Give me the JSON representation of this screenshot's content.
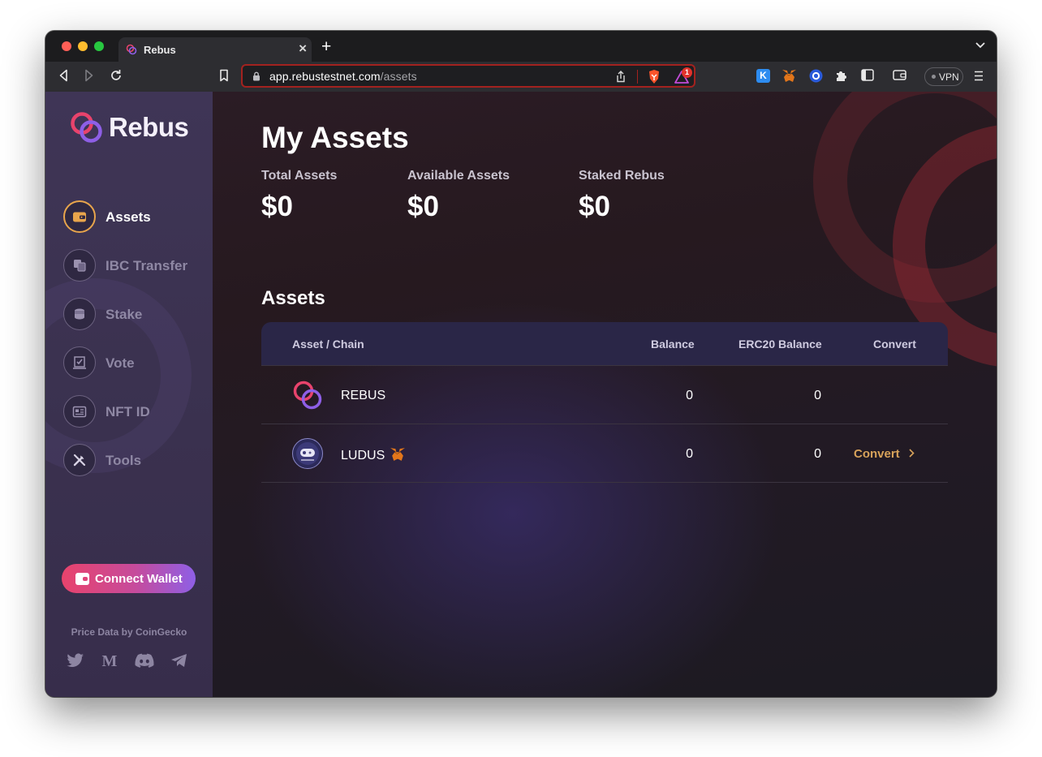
{
  "browser": {
    "tab_title": "Rebus",
    "url_host": "app.rebustestnet.com",
    "url_path": "/assets",
    "vpn_label": "VPN",
    "brave_badge": "1",
    "ext_k_label": "K"
  },
  "sidebar": {
    "logo_text": "Rebus",
    "items": [
      {
        "label": "Assets",
        "icon": "wallet-icon",
        "active": true
      },
      {
        "label": "IBC Transfer",
        "icon": "transfer-icon",
        "active": false
      },
      {
        "label": "Stake",
        "icon": "coins-icon",
        "active": false
      },
      {
        "label": "Vote",
        "icon": "vote-icon",
        "active": false
      },
      {
        "label": "NFT ID",
        "icon": "id-card-icon",
        "active": false
      },
      {
        "label": "Tools",
        "icon": "tools-icon",
        "active": false
      }
    ],
    "connect_label": "Connect Wallet",
    "price_credit": "Price Data by CoinGecko",
    "socials": [
      "twitter-icon",
      "medium-icon",
      "discord-icon",
      "telegram-icon"
    ]
  },
  "main": {
    "title": "My Assets",
    "stats": [
      {
        "label": "Total Assets",
        "value": "$0"
      },
      {
        "label": "Available Assets",
        "value": "$0"
      },
      {
        "label": "Staked Rebus",
        "value": "$0"
      }
    ],
    "section_title": "Assets",
    "table": {
      "headers": {
        "asset": "Asset / Chain",
        "balance": "Balance",
        "erc20": "ERC20 Balance",
        "convert": "Convert"
      },
      "rows": [
        {
          "name": "REBUS",
          "balance": "0",
          "erc20": "0",
          "convert": ""
        },
        {
          "name": "LUDUS",
          "balance": "0",
          "erc20": "0",
          "convert": "Convert"
        }
      ]
    }
  },
  "colors": {
    "accent": "#e8a54c",
    "brand_pink": "#e8436c",
    "brand_purple": "#8e5fe6",
    "sidebar_bg": "#3b3250",
    "table_header_bg": "#2a2647"
  }
}
